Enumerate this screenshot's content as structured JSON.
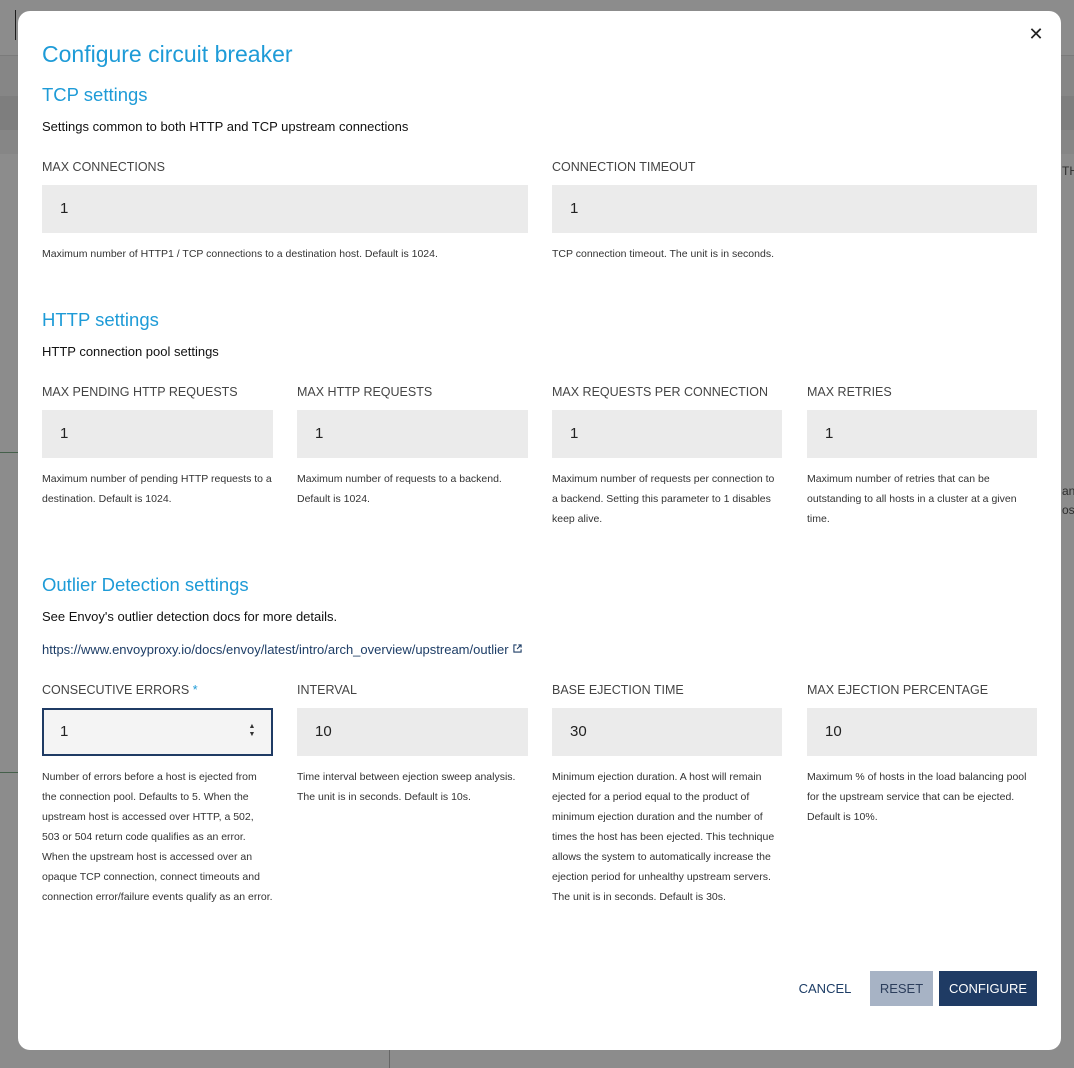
{
  "background": {
    "side_text_1": "TH",
    "side_text_2": "anc",
    "side_text_3": "ost"
  },
  "modal": {
    "title": "Configure circuit breaker",
    "close_label": "✕"
  },
  "tcp": {
    "title": "TCP settings",
    "description": "Settings common to both HTTP and TCP upstream connections",
    "fields": [
      {
        "label": "MAX CONNECTIONS",
        "value": "1",
        "help": "Maximum number of HTTP1 / TCP connections to a destination host. Default is 1024."
      },
      {
        "label": "CONNECTION TIMEOUT",
        "value": "1",
        "help": "TCP connection timeout. The unit is in seconds."
      }
    ]
  },
  "http": {
    "title": "HTTP settings",
    "description": "HTTP connection pool settings",
    "fields": [
      {
        "label": "MAX PENDING HTTP REQUESTS",
        "value": "1",
        "help": "Maximum number of pending HTTP requests to a destination. Default is 1024."
      },
      {
        "label": "MAX HTTP REQUESTS",
        "value": "1",
        "help": "Maximum number of requests to a backend. Default is 1024."
      },
      {
        "label": "MAX REQUESTS PER CONNECTION",
        "value": "1",
        "help": "Maximum number of requests per connection to a backend. Setting this parameter to 1 disables keep alive."
      },
      {
        "label": "MAX RETRIES",
        "value": "1",
        "help": "Maximum number of retries that can be outstanding to all hosts in a cluster at a given time."
      }
    ]
  },
  "outlier": {
    "title": "Outlier Detection settings",
    "description": "See Envoy's outlier detection docs for more details.",
    "link": "https://www.envoyproxy.io/docs/envoy/latest/intro/arch_overview/upstream/outlier",
    "required_mark": "*",
    "fields": [
      {
        "label": "CONSECUTIVE ERRORS",
        "value": "1",
        "help": "Number of errors before a host is ejected from the connection pool. Defaults to 5. When the upstream host is accessed over HTTP, a 502, 503 or 504 return code qualifies as an error. When the upstream host is accessed over an opaque TCP connection, connect timeouts and connection error/failure events qualify as an error."
      },
      {
        "label": "INTERVAL",
        "value": "10",
        "help": "Time interval between ejection sweep analysis. The unit is in seconds. Default is 10s."
      },
      {
        "label": "BASE EJECTION TIME",
        "value": "30",
        "help": "Minimum ejection duration. A host will remain ejected for a period equal to the product of minimum ejection duration and the number of times the host has been ejected. This technique allows the system to automatically increase the ejection period for unhealthy upstream servers. The unit is in seconds. Default is 30s."
      },
      {
        "label": "MAX EJECTION PERCENTAGE",
        "value": "10",
        "help": "Maximum % of hosts in the load balancing pool for the upstream service that can be ejected. Default is 10%."
      }
    ]
  },
  "footer": {
    "cancel_label": "CANCEL",
    "reset_label": "RESET",
    "configure_label": "CONFIGURE"
  },
  "colors": {
    "accent": "#1e9bd7",
    "primary_button": "#1f3b64",
    "reset_button": "#a7b3c5"
  }
}
